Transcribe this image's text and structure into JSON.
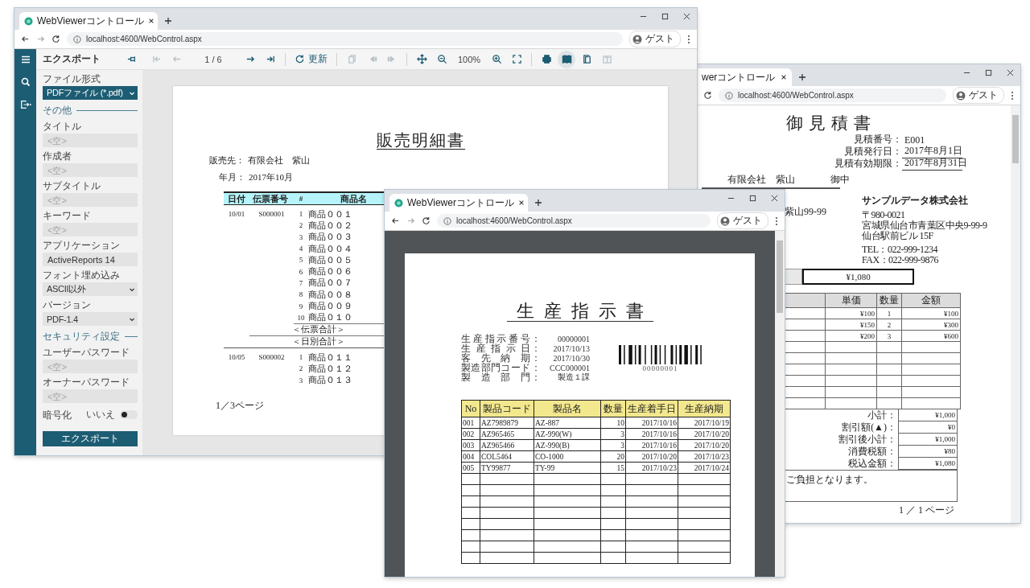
{
  "sales_window": {
    "tab_title": "WebViewerコントロール",
    "url": "localhost:4600/WebControl.aspx",
    "profile": "ゲスト",
    "panel_title": "エクスポート",
    "toolbar": {
      "groups": [
        [
          {
            "kind": "first",
            "disabled": true,
            "selected": false
          },
          {
            "kind": "prev",
            "disabled": true,
            "selected": false
          },
          {
            "kind": "page-indicator",
            "label": "1 / 6"
          },
          {
            "kind": "next",
            "disabled": false,
            "selected": false
          },
          {
            "kind": "last",
            "disabled": false,
            "selected": false
          }
        ],
        [
          {
            "kind": "refresh",
            "label": "更新",
            "disabled": false,
            "selected": false
          }
        ],
        [
          {
            "kind": "copy",
            "disabled": true,
            "selected": false
          },
          {
            "kind": "prev-section",
            "disabled": true,
            "selected": false
          },
          {
            "kind": "next-section",
            "disabled": true,
            "selected": false
          }
        ],
        [
          {
            "kind": "move",
            "disabled": false,
            "selected": false
          },
          {
            "kind": "zoom-out",
            "disabled": false,
            "selected": false
          },
          {
            "kind": "zoom-level",
            "label": "100%"
          },
          {
            "kind": "zoom-in",
            "disabled": false,
            "selected": false
          },
          {
            "kind": "fullscreen",
            "disabled": false,
            "selected": false
          }
        ],
        [
          {
            "kind": "print",
            "disabled": false,
            "selected": false
          },
          {
            "kind": "book",
            "disabled": false,
            "selected": true
          },
          {
            "kind": "single-page",
            "disabled": false,
            "selected": false
          },
          {
            "kind": "book-outline",
            "disabled": true,
            "selected": false
          }
        ]
      ]
    },
    "export_panel": {
      "items": [
        {
          "kind": "select",
          "label": "ファイル形式",
          "value": "PDFファイル (*.pdf)",
          "focused": true
        },
        {
          "kind": "section",
          "label": "その他"
        },
        {
          "kind": "text",
          "label": "タイトル",
          "placeholder": "<空>"
        },
        {
          "kind": "text",
          "label": "作成者",
          "placeholder": "<空>"
        },
        {
          "kind": "text",
          "label": "サブタイトル",
          "placeholder": "<空>"
        },
        {
          "kind": "text",
          "label": "キーワード",
          "placeholder": "<空>"
        },
        {
          "kind": "text",
          "label": "アプリケーション",
          "value": "ActiveReports 14"
        },
        {
          "kind": "select",
          "label": "フォント埋め込み",
          "value": "ASCII以外",
          "focused": false
        },
        {
          "kind": "select",
          "label": "バージョン",
          "value": "PDF-1.4",
          "focused": false
        },
        {
          "kind": "section",
          "label": "セキュリティ設定"
        },
        {
          "kind": "text",
          "label": "ユーザーパスワード",
          "placeholder": "<空>"
        },
        {
          "kind": "text",
          "label": "オーナーパスワード",
          "placeholder": "<空>"
        },
        {
          "kind": "toggle",
          "label": "暗号化",
          "value": "いいえ",
          "on": false
        }
      ],
      "button": "エクスポート"
    },
    "report": {
      "title": "販売明細書",
      "customer_label": "販売先：",
      "customer": "有限会社　紫山",
      "month_label": "年月：",
      "month": "2017年10月",
      "columns": [
        "日付",
        "伝票番号",
        "#",
        "商品名"
      ],
      "groups": [
        {
          "date": "10/01",
          "slip": "S000001",
          "items": [
            {
              "no": "1",
              "name": "商品００１"
            },
            {
              "no": "2",
              "name": "商品００２"
            },
            {
              "no": "3",
              "name": "商品００３"
            },
            {
              "no": "4",
              "name": "商品００４"
            },
            {
              "no": "5",
              "name": "商品００５"
            },
            {
              "no": "6",
              "name": "商品００６"
            },
            {
              "no": "7",
              "name": "商品００７"
            },
            {
              "no": "8",
              "name": "商品００８"
            },
            {
              "no": "9",
              "name": "商品００９"
            },
            {
              "no": "10",
              "name": "商品０１０"
            }
          ],
          "slip_total": "＜伝票合計＞",
          "day_total": "＜日別合計＞"
        },
        {
          "date": "10/05",
          "slip": "S000002",
          "items": [
            {
              "no": "1",
              "name": "商品０１１"
            },
            {
              "no": "2",
              "name": "商品０１２"
            },
            {
              "no": "3",
              "name": "商品０１３"
            }
          ]
        }
      ],
      "footer": "1／3ページ"
    }
  },
  "quote_window": {
    "tab_title": "werコントロール",
    "url": "localhost:4600/WebControl.aspx",
    "profile": "ゲスト",
    "title": "御見積書",
    "meta": [
      {
        "label": "見積番号：",
        "value": "E001"
      },
      {
        "label": "見積発行日：",
        "value": "2017年8月1日"
      },
      {
        "label": "見積有効期限：",
        "value": "2017年8月31日"
      }
    ],
    "customer": "有限会社　紫山",
    "honorific": "御中",
    "address_fragment": "紫山99-99",
    "company": {
      "name": "サンプルデータ株式会社",
      "lines": [
        "〒980-0021",
        "宮城県仙台市青葉区中央9-99-9",
        "仙台駅前ビル 15F"
      ],
      "contacts": [
        "TEL：022-999-1234",
        "FAX：022-999-9876"
      ]
    },
    "total": "¥1,080",
    "columns": [
      "単価",
      "数量",
      "金額"
    ],
    "rows": [
      [
        "¥100",
        "1",
        "¥100"
      ],
      [
        "¥150",
        "2",
        "¥300"
      ],
      [
        "¥200",
        "3",
        "¥600"
      ]
    ],
    "summary": [
      {
        "label": "小計：",
        "value": "¥1,000"
      },
      {
        "label": "割引額(▲)：",
        "value": "¥0"
      },
      {
        "label": "割引後小計：",
        "value": "¥1,000"
      },
      {
        "label": "消費税額：",
        "value": "¥80"
      },
      {
        "label": "税込金額：",
        "value": "¥1,080"
      }
    ],
    "note": "ご負担となります。",
    "footer": "1 ／ 1 ページ"
  },
  "production_window": {
    "tab_title": "WebViewerコントロール",
    "url": "localhost:4600/WebControl.aspx",
    "profile": "ゲスト",
    "title": "生産指示書",
    "info": [
      {
        "label": "生産指示番号",
        "sep": "：",
        "value": "00000001"
      },
      {
        "label": "生産指示日",
        "sep": "：",
        "value": "2017/10/13"
      },
      {
        "label": "客先納期",
        "sep": "：",
        "value": "2017/10/30"
      },
      {
        "label": "製造部門コード",
        "sep": "：",
        "value": "CCC000001"
      },
      {
        "label": "製造部門",
        "sep": "：",
        "value": "製造１課"
      }
    ],
    "barcode_caption": "00000001",
    "columns": [
      "No",
      "製品コード",
      "製品名",
      "数量",
      "生産着手日",
      "生産納期"
    ],
    "rows": [
      [
        "001",
        "AZ7989879",
        "AZ-887",
        "10",
        "2017/10/16",
        "2017/10/19"
      ],
      [
        "002",
        "AZ965465",
        "AZ-990(W)",
        "3",
        "2017/10/16",
        "2017/10/20"
      ],
      [
        "003",
        "AZ965466",
        "AZ-990(B)",
        "3",
        "2017/10/16",
        "2017/10/20"
      ],
      [
        "004",
        "COL5464",
        "CO-1000",
        "20",
        "2017/10/20",
        "2017/10/23"
      ],
      [
        "005",
        "TY99877",
        "TY-99",
        "15",
        "2017/10/23",
        "2017/10/24"
      ]
    ]
  }
}
